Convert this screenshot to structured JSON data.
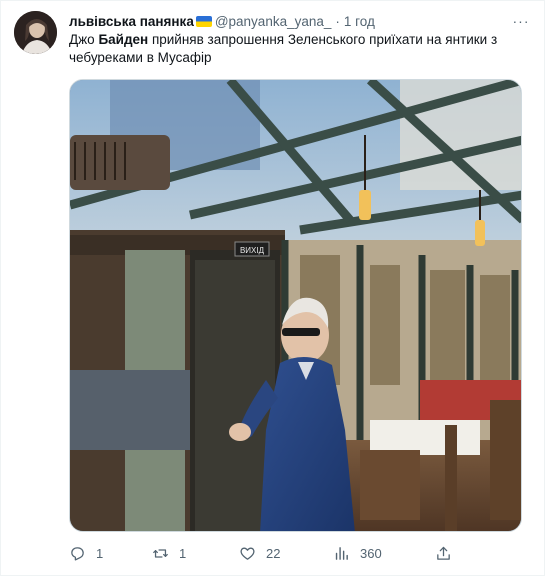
{
  "tweet": {
    "display_name": "львівська панянка",
    "handle": "@panyanka_yana_",
    "separator": "·",
    "time": "1 год",
    "more_label": "···",
    "text_before": "Джо ",
    "text_bold": "Байден",
    "text_after": " прийняв запрошення Зеленського приїхати на янтики з чебуреками в Мусафір"
  },
  "media": {
    "exit_sign": "ВИХІД"
  },
  "actions": {
    "reply_count": "1",
    "retweet_count": "1",
    "like_count": "22",
    "views_count": "360"
  },
  "icons": {
    "reply": "reply-icon",
    "retweet": "retweet-icon",
    "like": "heart-icon",
    "views": "views-icon",
    "share": "share-icon"
  },
  "colors": {
    "text_primary": "#0f1419",
    "text_secondary": "#536471",
    "border": "#cfd9de",
    "flag_blue": "#2a6fd6",
    "flag_yellow": "#ffd500"
  }
}
